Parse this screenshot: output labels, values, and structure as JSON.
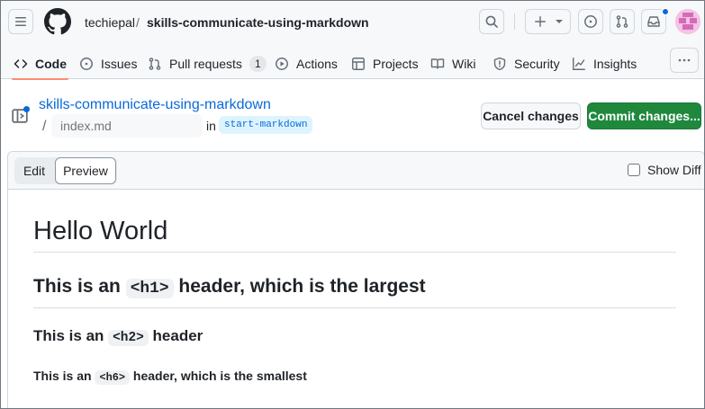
{
  "header": {
    "owner": "techiepal",
    "separator": "/",
    "repo": "skills-communicate-using-markdown"
  },
  "tabs": [
    {
      "label": "Code",
      "icon": "code-icon",
      "active": true
    },
    {
      "label": "Issues",
      "icon": "issue-opened-icon"
    },
    {
      "label": "Pull requests",
      "icon": "git-pull-request-icon",
      "count": "1"
    },
    {
      "label": "Actions",
      "icon": "play-icon"
    },
    {
      "label": "Projects",
      "icon": "table-icon"
    },
    {
      "label": "Wiki",
      "icon": "book-icon"
    },
    {
      "label": "Security",
      "icon": "shield-icon"
    },
    {
      "label": "Insights",
      "icon": "graph-icon"
    }
  ],
  "edit_bar": {
    "repo_link": "skills-communicate-using-markdown",
    "path_separator": "/",
    "filename": "",
    "filename_placeholder": "index.md",
    "in_label": "in",
    "branch": "start-markdown",
    "cancel_label": "Cancel changes",
    "commit_label": "Commit changes..."
  },
  "editor": {
    "edit_tab": "Edit",
    "preview_tab": "Preview",
    "active_tab": "Preview",
    "show_diff_label": "Show Diff",
    "show_diff_checked": false
  },
  "preview": {
    "h1": "Hello World",
    "h2_pre": "This is an ",
    "h2_code": "<h1>",
    "h2_post": " header, which is the largest",
    "h3_pre": "This is an ",
    "h3_code": "<h2>",
    "h3_post": " header",
    "h6_pre": "This is an ",
    "h6_code": "<h6>",
    "h6_post": " header, which is the smallest"
  },
  "colors": {
    "accent": "#0969da",
    "commit_button": "#1f883d",
    "active_tab_underline": "#fd8c73",
    "notification_dot": "#0969da"
  }
}
